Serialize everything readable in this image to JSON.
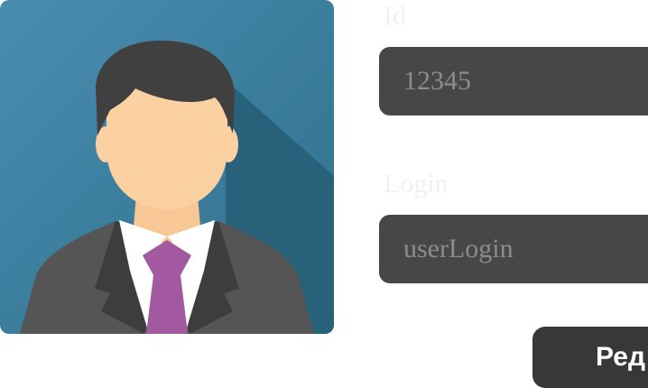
{
  "profile": {
    "avatar_icon": "user-businessman-icon",
    "id": {
      "label": "Id",
      "value": "12345"
    },
    "login": {
      "label": "Login",
      "value": "userLogin"
    },
    "edit_button_label": "Ред"
  },
  "colors": {
    "avatar_background": "#3d85a7",
    "avatar_shadow": "#2a5e72",
    "input_background": "#474747",
    "input_text": "#8c8c8c",
    "label_text": "#f1f1f1",
    "button_background": "#383838",
    "button_text": "#ffffff"
  }
}
